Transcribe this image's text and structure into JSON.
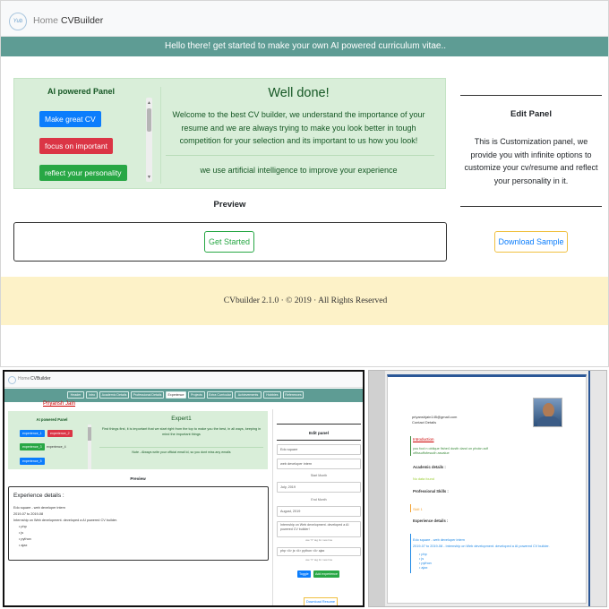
{
  "top": {
    "nav": {
      "logo": "Yub",
      "home": "Home",
      "brand": "CVBuilder"
    },
    "banner": "Hello there! get started to make your own AI powered curriculum vitae..",
    "ai_panel": {
      "title": "AI powered Panel",
      "buttons": [
        "Make great CV",
        "focus on important",
        "reflect your personality"
      ]
    },
    "welcome": {
      "title": "Well done!",
      "text": "Welcome to the best CV builder, we understand the importance of your resume and we are always trying to make you look better in tough competition for your selection and its important to us how you look!",
      "ai_note": "we use artificial intelligence to improve your experience"
    },
    "preview_label": "Preview",
    "get_started": "Get Started",
    "edit_panel": {
      "title": "Edit Panel",
      "text": "This is Customization panel, we provide you with infinite options to customize your cv/resume and reflect your personality in it."
    },
    "download_sample": "Download Sample",
    "footer": "CVbuilder 2.1.0 · © 2019 · All Rights Reserved"
  },
  "bottom_left": {
    "nav": {
      "home": "Home",
      "brand": "CVBuilder"
    },
    "tabs": [
      "Header",
      "Intro",
      "Academic Details",
      "Professional Details",
      "Experience",
      "Projects",
      "Extra Curricular",
      "Achievements",
      "Hobbies",
      "References"
    ],
    "ai_panel": {
      "title": "AI powered Panel",
      "items": [
        "experience_1",
        "experience_2",
        "experience_3",
        "experience_4",
        "experience_5"
      ]
    },
    "expert": {
      "title": "Expert1",
      "text": "First things first, it is important that we start right from the top to make you the best, in all ways, keeping in mind the important things",
      "note": "Note - Always write your official email id, so you dont miss any emails"
    },
    "preview_label": "Preview",
    "details": {
      "title": "Experience details :",
      "company": "Edo square - web developer intern",
      "dates": "2019-07 to 2019-08",
      "desc": "Internship on Web development. developed a AI powered CV builder.",
      "skills": [
        "php",
        "js",
        "python",
        "ajax"
      ]
    },
    "edit_panel": {
      "title": "Edit panel",
      "company": "Edo square",
      "role": "web developer intern",
      "start_label": "Start Month",
      "start": "July, 2019",
      "end_label": "End Month",
      "end": "August, 2019",
      "desc": "Internship on Web development. developed a AI powered CV builder!",
      "desc_hint": "use \"li\" tag for new line",
      "skills": "php <li> js <li> python <li> ajax",
      "skills_hint": "use \"li\" tag for new line",
      "toggle": "Toggle",
      "add": "Add experience",
      "download": "Download Resume"
    }
  },
  "bottom_right": {
    "name": "Priyansh Jain",
    "email": "priyanshjain145@gmail.com",
    "contact": "Contact Details",
    "intro_title": "Introduction",
    "intro_text": "you fool n oblique fishe4 dusth dand on phokn adf offissuffofesudh asvalue",
    "academic": "Academic details :",
    "academic_sub": "No data found",
    "professional": "Professional Skills :",
    "skill": "Skill 1",
    "experience": "Experience details :",
    "exp_company": "Edo square - web developer intern",
    "exp_desc": "2019-07 to 2019-08 - Internship on Web development. developed a AI powered CV builder.",
    "skills": [
      "php",
      "js",
      "python",
      "ajax"
    ]
  },
  "colors": {
    "teal": "#5e9c94",
    "green_panel": "#d9eed9",
    "primary": "#0b7dfc",
    "danger": "#db3545",
    "success": "#28a745",
    "footer": "#fdf2c8"
  }
}
